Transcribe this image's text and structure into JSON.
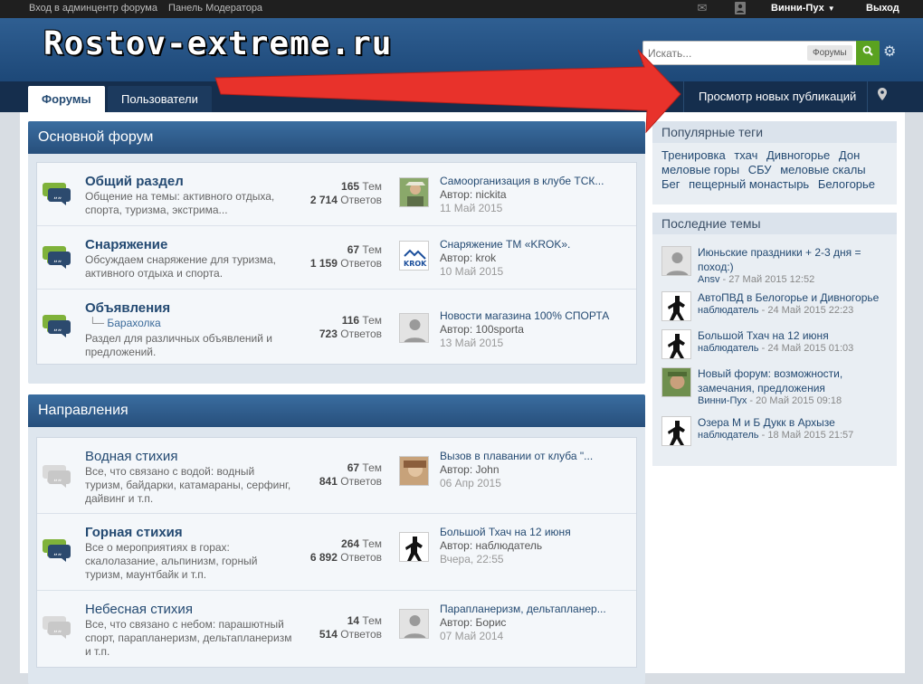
{
  "adminbar": {
    "admin_link": "Вход в админцентр форума",
    "moderator_link": "Панель Модератора",
    "username": "Винни-Пух",
    "logout": "Выход"
  },
  "header": {
    "logo_text": "Rostov-extreme.ru",
    "search_placeholder": "Искать...",
    "search_scope": "Форумы"
  },
  "nav": {
    "tabs": [
      "Форумы",
      "Пользователи"
    ],
    "new_content": "Просмотр новых публикаций"
  },
  "sections": [
    {
      "title": "Основной форум",
      "forums": [
        {
          "name": "Общий раздел",
          "desc": "Общение на темы: активного отдыха, спорта, туризма, экстрима...",
          "subforum": "",
          "topics": "165",
          "topics_label": "Тем",
          "replies": "2 714",
          "replies_label": "Ответов",
          "last_title": "Самоорганизация в клубе ТСК...",
          "last_author": "Автор: nickita",
          "last_date": "11 Май 2015",
          "unread": true
        },
        {
          "name": "Снаряжение",
          "desc": "Обсуждаем снаряжение для туризма, активного отдыха и спорта.",
          "subforum": "",
          "topics": "67",
          "topics_label": "Тем",
          "replies": "1 159",
          "replies_label": "Ответов",
          "last_title": "Снаряжение ТМ «KROK».",
          "last_author": "Автор: krok",
          "last_date": "10 Май 2015",
          "unread": true
        },
        {
          "name": "Объявления",
          "desc": "Раздел для различных объявлений и предложений.",
          "subforum": "Барахолка",
          "topics": "116",
          "topics_label": "Тем",
          "replies": "723",
          "replies_label": "Ответов",
          "last_title": "Новости магазина 100% СПОРТА",
          "last_author": "Автор: 100sporta",
          "last_date": "13 Май 2015",
          "unread": true
        }
      ]
    },
    {
      "title": "Направления",
      "forums": [
        {
          "name": "Водная стихия",
          "desc": "Все, что связано с водой: водный туризм, байдарки, катамараны, серфинг, дайвинг и т.п.",
          "subforum": "",
          "topics": "67",
          "topics_label": "Тем",
          "replies": "841",
          "replies_label": "Ответов",
          "last_title": "Вызов в плавании от клуба \"...",
          "last_author": "Автор: John",
          "last_date": "06 Апр 2015",
          "unread": false
        },
        {
          "name": "Горная стихия",
          "desc": "Все о мероприятиях в горах: скалолазание, альпинизм, горный туризм, маунтбайк и т.п.",
          "subforum": "",
          "topics": "264",
          "topics_label": "Тем",
          "replies": "6 892",
          "replies_label": "Ответов",
          "last_title": "Большой Тхач на 12 июня",
          "last_author": "Автор: наблюдатель",
          "last_date": "Вчера, 22:55",
          "unread": true
        },
        {
          "name": "Небесная стихия",
          "desc": "Все, что связано с небом: парашютный спорт, парапланеризм, дельтапланеризм и т.п.",
          "subforum": "",
          "topics": "14",
          "topics_label": "Тем",
          "replies": "514",
          "replies_label": "Ответов",
          "last_title": "Парапланеризм, дельтапланер...",
          "last_author": "Автор: Борис",
          "last_date": "07 Май 2014",
          "unread": false
        }
      ]
    }
  ],
  "sidebar": {
    "tags_title": "Популярные теги",
    "tags": [
      "Тренировка",
      "тхач",
      "Дивногорье",
      "Дон",
      "меловые горы",
      "СБУ",
      "меловые скалы",
      "Бег",
      "пещерный монастырь",
      "Белогорье"
    ],
    "recent_title": "Последние темы",
    "threads": [
      {
        "title": "Июньские праздники + 2-3 дня = поход:)",
        "author": "Ansv",
        "date": "- 27 Май 2015 12:52"
      },
      {
        "title": "АвтоПВД в Белогорье и Дивногорье",
        "author": "наблюдатель",
        "date": "- 24 Май 2015 22:23"
      },
      {
        "title": "Большой Тхач на 12 июня",
        "author": "наблюдатель",
        "date": "- 24 Май 2015 01:03"
      },
      {
        "title": "Новый форум: возможности, замечания, предложения",
        "author": "Винни-Пух",
        "date": "- 20 Май 2015 09:18"
      },
      {
        "title": "Озера М и Б Дукк в Архызе",
        "author": "наблюдатель",
        "date": "- 18 Май 2015 21:57"
      }
    ]
  },
  "colors": {
    "accent": "#244a72",
    "header": "#2f5f92",
    "nav": "#152e4d",
    "annotation_arrow": "#e8322b"
  }
}
